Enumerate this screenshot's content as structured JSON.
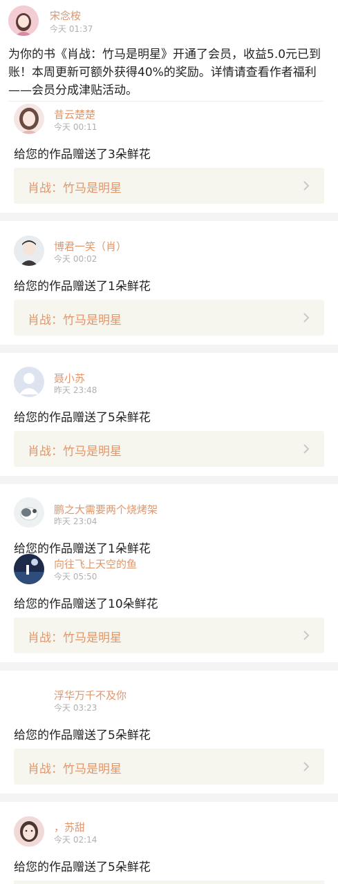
{
  "notice": {
    "user": "宋念桉",
    "time": "今天 01:37",
    "text": "为你的书《肖战：竹马是明星》开通了会员，收益5.0元已到账！本周更新可额外获得40%的奖励。详情请查看作者福利——会员分成津贴活动。"
  },
  "book_title": "肖战：竹马是明星",
  "items": [
    {
      "user": "昔云楚楚",
      "time": "今天 00:11",
      "msg": "给您的作品赠送了3朵鲜花"
    },
    {
      "user": "博君一笑（肖）",
      "time": "今天 00:02",
      "msg": "给您的作品赠送了1朵鲜花"
    },
    {
      "user": "聂小苏",
      "time": "昨天 23:48",
      "msg": "给您的作品赠送了5朵鲜花"
    },
    {
      "user": "鹏之大需要两个烧烤架",
      "time": "昨天 23:04",
      "msg": "给您的作品赠送了1朵鲜花"
    },
    {
      "user": "向往飞上天空的鱼",
      "time": "今天 05:50",
      "msg": "给您的作品赠送了10朵鲜花"
    },
    {
      "user": "浮华万千不及你",
      "time": "今天 03:23",
      "msg": "给您的作品赠送了5朵鲜花"
    },
    {
      "user": "，苏甜",
      "time": "今天 02:14",
      "msg": "给您的作品赠送了5朵鲜花"
    }
  ],
  "icons": {
    "chevron": "chevron-right-icon",
    "default_avatar": "user-silhouette-icon"
  },
  "colors": {
    "accent": "#e0966a",
    "card_bg": "#f7f6ee",
    "divider": "#f4f4f4"
  }
}
